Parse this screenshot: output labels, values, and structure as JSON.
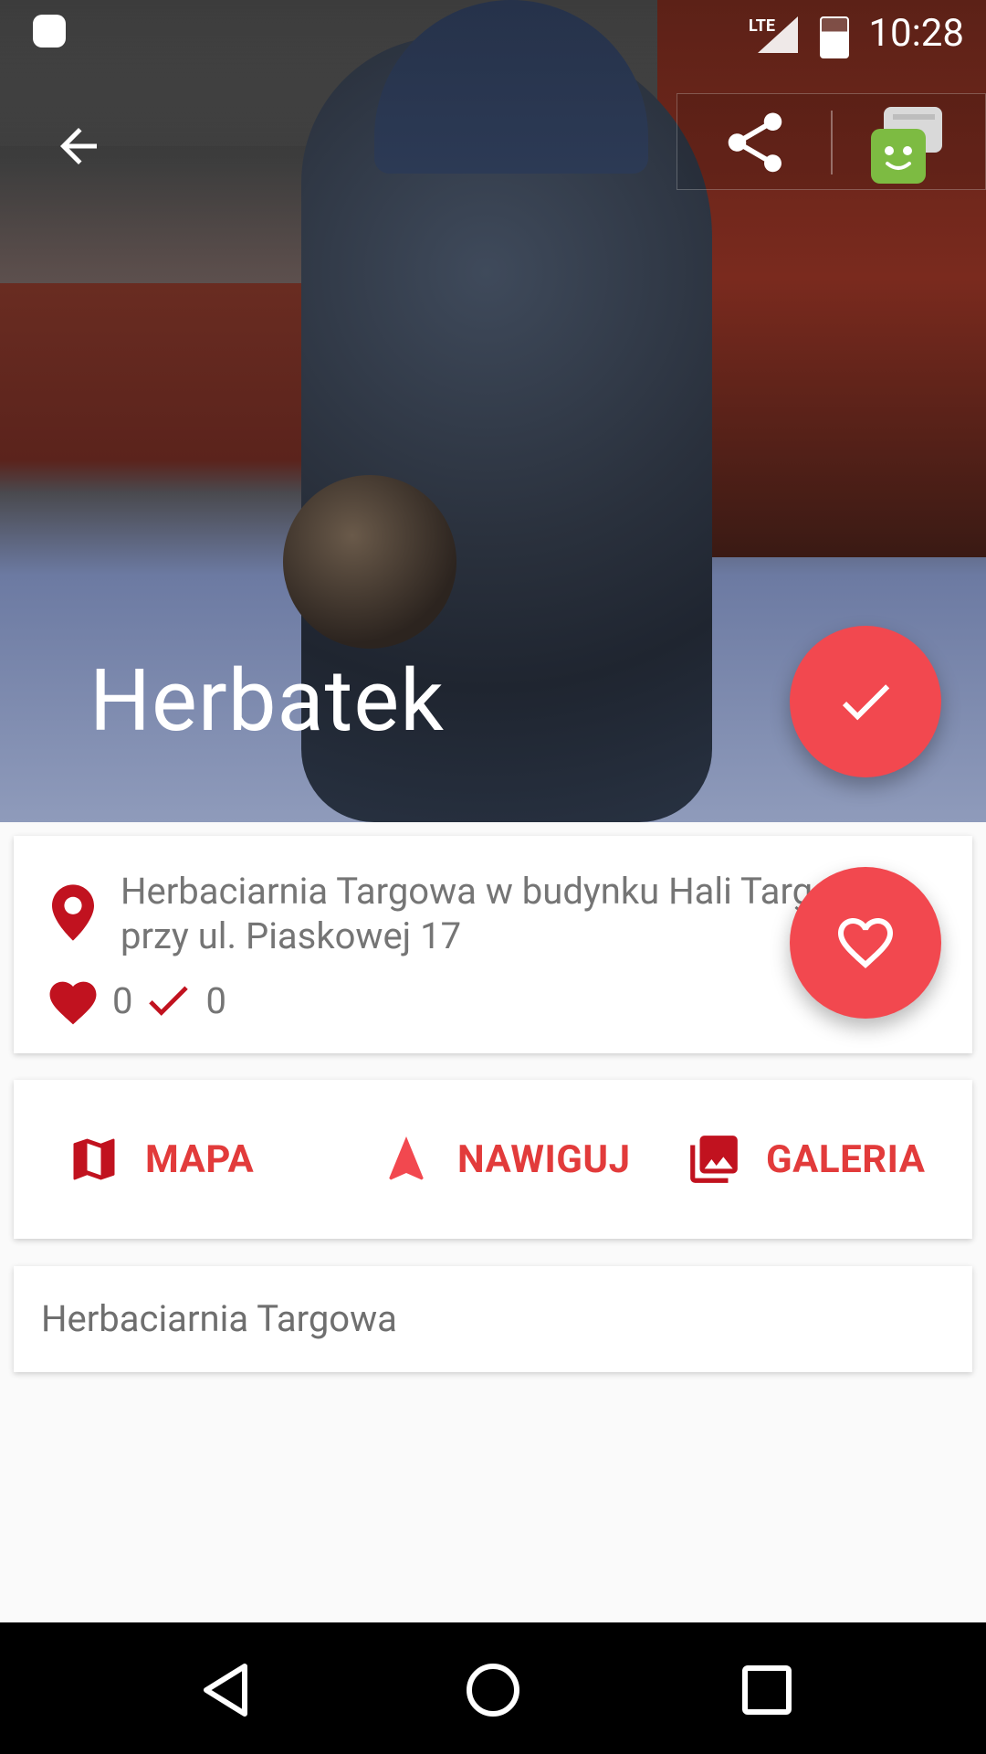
{
  "status_bar": {
    "time": "10:28",
    "network": "LTE"
  },
  "header": {
    "title": "Herbatek"
  },
  "info": {
    "address": "Herbaciarnia Targowa w budynku Hali Targowej przy ul. Piaskowej 17",
    "likes": "0",
    "checks": "0"
  },
  "actions": {
    "map_label": "MAPA",
    "navigate_label": "NAWIGUJ",
    "gallery_label": "GALERIA"
  },
  "place": {
    "name": "Herbaciarnia Targowa"
  },
  "colors": {
    "accent": "#f2484f",
    "action_text": "#e23b3b",
    "icon_red": "#c1121f"
  },
  "icons": [
    "back-arrow-icon",
    "share-icon",
    "bot-icon",
    "check-icon",
    "heart-icon",
    "location-pin-icon",
    "map-icon",
    "navigation-arrow-icon",
    "gallery-icon"
  ]
}
